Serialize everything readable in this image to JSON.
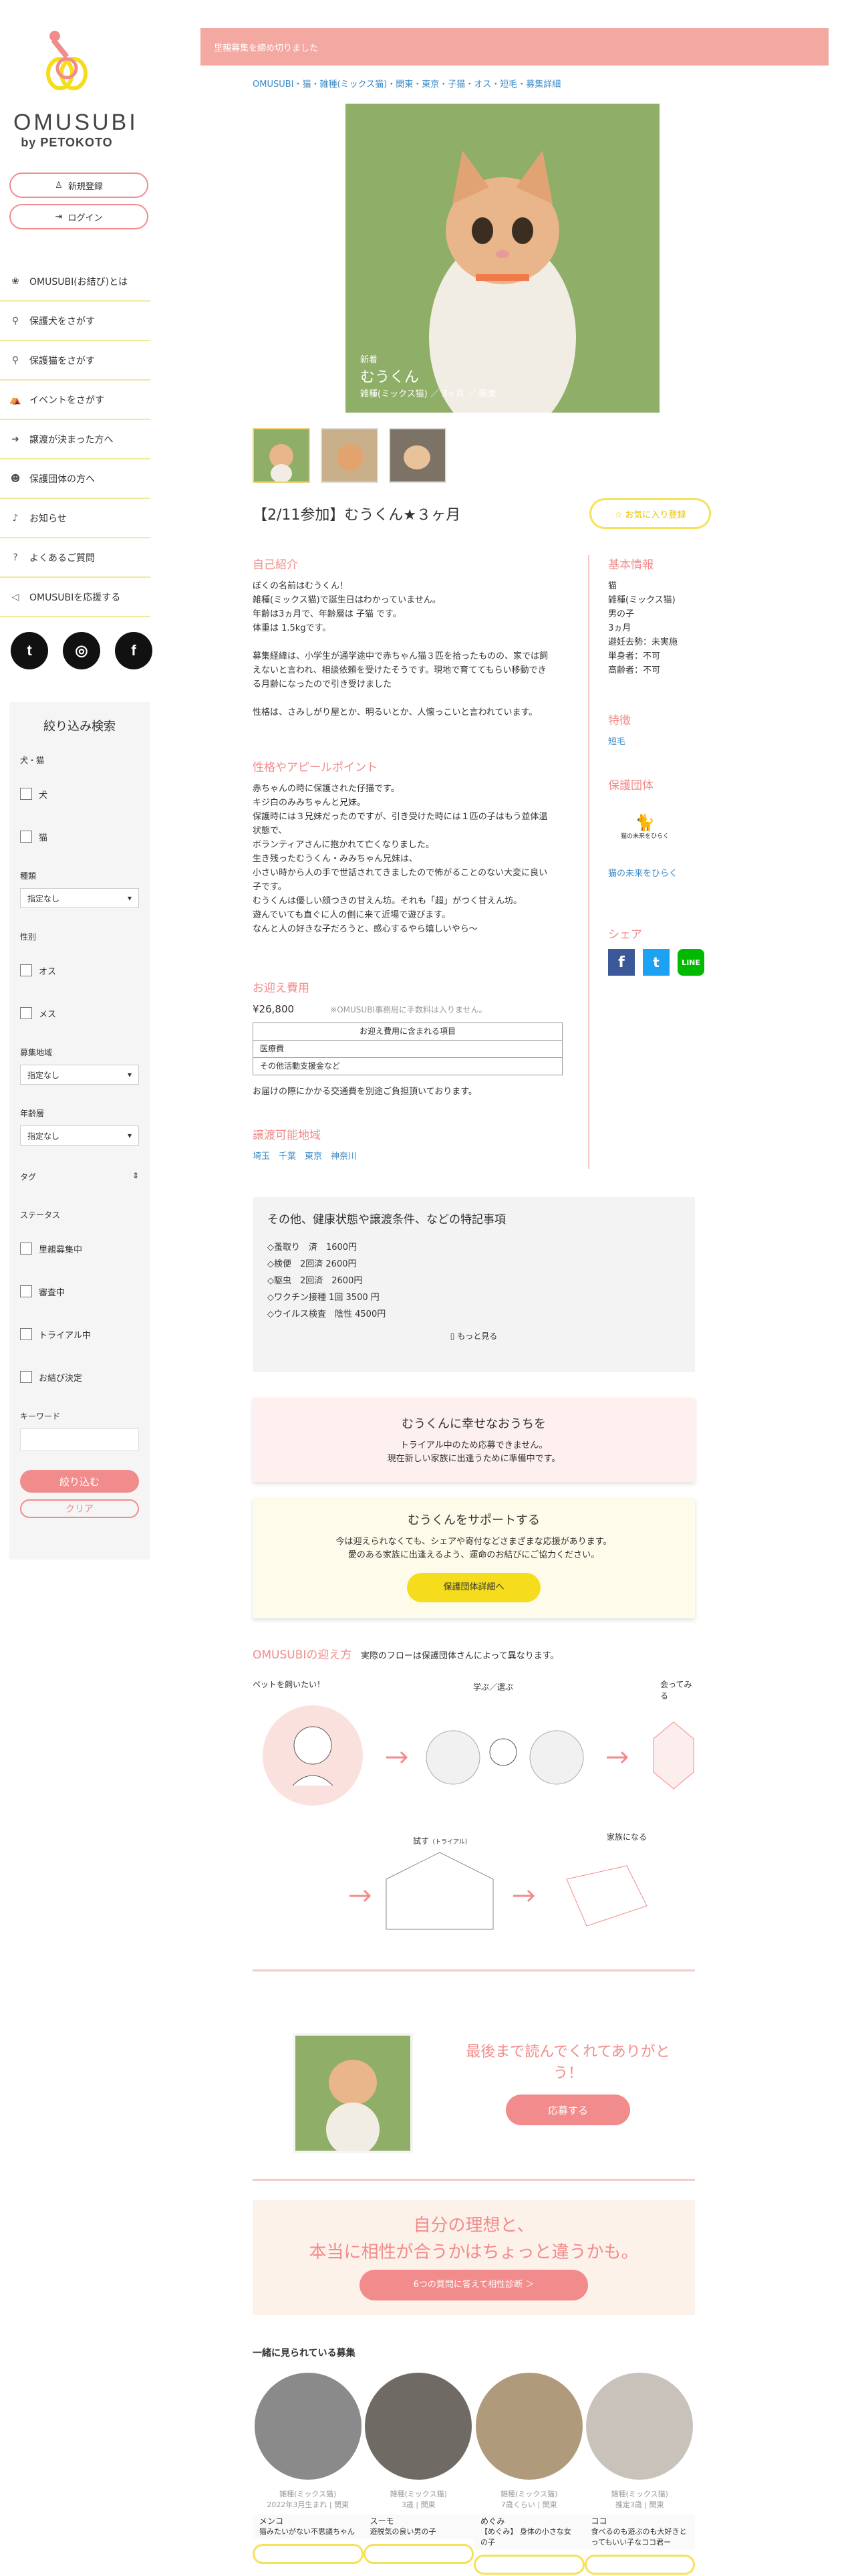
{
  "brand": {
    "name": "OMUSUBI",
    "sub": "by PETOKOTO"
  },
  "auth": {
    "register": "新規登録",
    "login": "ログイン"
  },
  "nav": [
    {
      "label": "OMUSUBI(お結び)とは"
    },
    {
      "label": "保護犬をさがす"
    },
    {
      "label": "保護猫をさがす"
    },
    {
      "label": "イベントをさがす"
    },
    {
      "label": "譲渡が決まった方へ"
    },
    {
      "label": "保護団体の方へ"
    },
    {
      "label": "お知らせ"
    },
    {
      "label": "よくあるご質問"
    },
    {
      "label": "OMUSUBIを応援する"
    }
  ],
  "filter": {
    "title": "絞り込み検索",
    "species_label": "犬・猫",
    "species": [
      "犬",
      "猫"
    ],
    "breed_label": "種類",
    "breed_value": "指定なし",
    "sex_label": "性別",
    "sex": [
      "オス",
      "メス"
    ],
    "area_label": "募集地域",
    "area_value": "指定なし",
    "age_label": "年齢層",
    "age_value": "指定なし",
    "tag_label": "タグ",
    "status_label": "ステータス",
    "status": [
      "里親募集中",
      "審査中",
      "トライアル中",
      "お結び決定"
    ],
    "keyword_label": "キーワード",
    "submit": "絞り込む",
    "clear": "クリア"
  },
  "notice": "里親募集を締め切りました",
  "breadcrumb": "OMUSUBI・猫・雑種(ミックス猫)・関東・東京・子猫・オス・短毛・募集詳細",
  "hero": {
    "badge": "新着",
    "name": "むうくん",
    "meta": "雑種(ミックス猫) ／ 3ヶ月 ／ 関東"
  },
  "title": "【2/11参加】むうくん★３ヶ月",
  "fav_button": "☆ お気に入り登録",
  "intro": {
    "heading": "自己紹介",
    "lines": [
      "ぼくの名前はむうくん！",
      "雑種(ミックス猫)で誕生日はわかっていません。",
      "年齢は3ヵ月で、年齢層は 子猫 です。",
      "体重は 1.5kgです。",
      "",
      "募集経緯は、小学生が通学途中で赤ちゃん猫３匹を拾ったものの、家では飼",
      "えないと言われ、相談依頼を受けたそうです。現地で育ててもらい移動でき",
      "る月齢になったので引き受けました",
      "",
      "性格は、さみしがり屋とか、明るいとか、人懐っこいと言われています。"
    ]
  },
  "appeal": {
    "heading": "性格やアピールポイント",
    "lines": [
      "赤ちゃんの時に保護された仔猫です。",
      "キジ白のみみちゃんと兄妹。",
      "保護時には３兄妹だったのですが、引き受けた時には１匹の子はもう並体温",
      "状態で、",
      "ボランティアさんに抱かれて亡くなりました。",
      "生き残ったむうくん・みみちゃん兄妹は、",
      "小さい時から人の手で世話されてきましたので怖がることのない大変に良い",
      "子です。",
      "むうくんは優しい顔つきの甘えん坊。それも「超」がつく甘えん坊。",
      "遊んでいても直ぐに人の側に来て近場で遊びます。",
      "なんと人の好きな子だろうと、感心するやら嬉しいやら〜"
    ]
  },
  "fee": {
    "heading": "お迎え費用",
    "amount": "¥26,800",
    "note": "※OMUSUBI事務局に手数料は入りません。",
    "table_header": "お迎え費用に含まれる項目",
    "items": [
      "医療費",
      "その他活動支援金など"
    ],
    "footnote": "お届けの際にかかる交通費を別途ご負担頂いております。"
  },
  "area": {
    "heading": "譲渡可能地域",
    "list": "埼玉　千葉　東京　神奈川"
  },
  "basic": {
    "heading": "基本情報",
    "lines": [
      "猫",
      "雑種(ミックス猫)",
      "男の子",
      "3ヵ月",
      "避妊去勢：未実施",
      "単身者：不可",
      "高齢者：不可"
    ]
  },
  "features": {
    "heading": "特徴",
    "tag": "短毛"
  },
  "org": {
    "heading": "保護団体",
    "logo_text": "猫の未来をひらく",
    "link": "猫の未来をひらく"
  },
  "share": {
    "heading": "シェア"
  },
  "conditions": {
    "heading": "その他、健康状態や譲渡条件、などの特記事項",
    "lines": [
      "◇蚤取り　済　1600円",
      "◇検便　2回済 2600円",
      "◇駆虫　2回済　2600円",
      "◇ワクチン接種 1回 3500 円",
      "◇ウイルス検査　陰性 4500円"
    ],
    "more": "もっと見る"
  },
  "happy": {
    "heading": "むうくんに幸せなおうちを",
    "line1": "トライアル中のため応募できません。",
    "line2": "現在新しい家族に出逢うために準備中です。"
  },
  "support": {
    "heading": "むうくんをサポートする",
    "line1": "今は迎えられなくても、シェアや寄付などさまざまな応援があります。",
    "line2": "愛のある家族に出逢えるよう、運命のお結びにご協力ください。",
    "button": "保護団体詳細へ"
  },
  "flow": {
    "brand": "OMUSUBIの迎え方",
    "text": "実際のフローは保護団体さんによって異なります。",
    "steps": [
      "ペットを飼いたい！",
      "学ぶ／選ぶ",
      "会ってみる",
      "試す",
      "（トライアル）",
      "家族になる"
    ]
  },
  "thanks": {
    "text": "最後まで読んでくれてありがとう！",
    "button": "応募する"
  },
  "banner": {
    "line1": "自分の理想と、",
    "line2": "本当に相性が合うかはちょっと違うかも。",
    "button": "6つの質問に答えて相性診断 ＞"
  },
  "related": {
    "heading": "一緒に見られている募集",
    "items": [
      {
        "meta": "雑種(ミックス猫)",
        "age": "2022年3月生まれ | 関東",
        "name": "メンコ",
        "desc": "猫みたいがない不思議ちゃん"
      },
      {
        "meta": "雑種(ミックス猫)",
        "age": "3歳 | 関東",
        "name": "スーモ",
        "desc": "遊脱気の良い男の子"
      },
      {
        "meta": "雑種(ミックス猫)",
        "age": "7歳くらい | 関東",
        "name": "めぐみ",
        "desc": "【めぐみ】 身体の小さな女の子"
      },
      {
        "meta": "雑種(ミックス猫)",
        "age": "推定3歳 | 関東",
        "name": "ココ",
        "desc": "食べるのも遊ぶのも大好きとってもいい子なココ君ー"
      }
    ]
  }
}
